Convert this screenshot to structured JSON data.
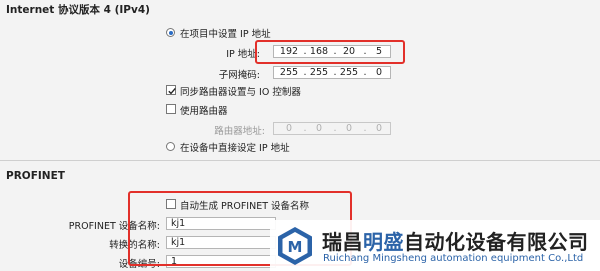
{
  "ipv4": {
    "title": "Internet 协议版本 4 (IPv4)",
    "set_in_project_label": "在项目中设置 IP 地址",
    "ip_label": "IP 地址:",
    "ip": [
      "192",
      "168",
      "20",
      "5"
    ],
    "subnet_label": "子网掩码:",
    "subnet": [
      "255",
      "255",
      "255",
      "0"
    ],
    "sync_router_label": "同步路由器设置与 IO 控制器",
    "use_router_label": "使用路由器",
    "router_addr_label": "路由器地址:",
    "router": [
      "0",
      "0",
      "0",
      "0"
    ],
    "set_on_device_label": "在设备中直接设定 IP 地址"
  },
  "profinet": {
    "title": "PROFINET",
    "auto_generate_label": "自动生成 PROFINET 设备名称",
    "device_name_label": "PROFINET 设备名称:",
    "device_name_value": "kj1",
    "converted_name_label": "转换的名称:",
    "converted_name_value": "kj1",
    "device_number_label": "设备编号:",
    "device_number_value": "1"
  },
  "watermark": {
    "company_cn_part1": "瑞昌",
    "company_cn_part2": "明盛",
    "company_cn_part3": "自动化设备有限公司",
    "company_en": "Ruichang Mingsheng automation equipment Co.,Ltd",
    "logo_letter": "M",
    "colors": {
      "blue": "#2b63a8",
      "red": "#e2302a",
      "accent_blue": "#2b6cc4"
    }
  }
}
